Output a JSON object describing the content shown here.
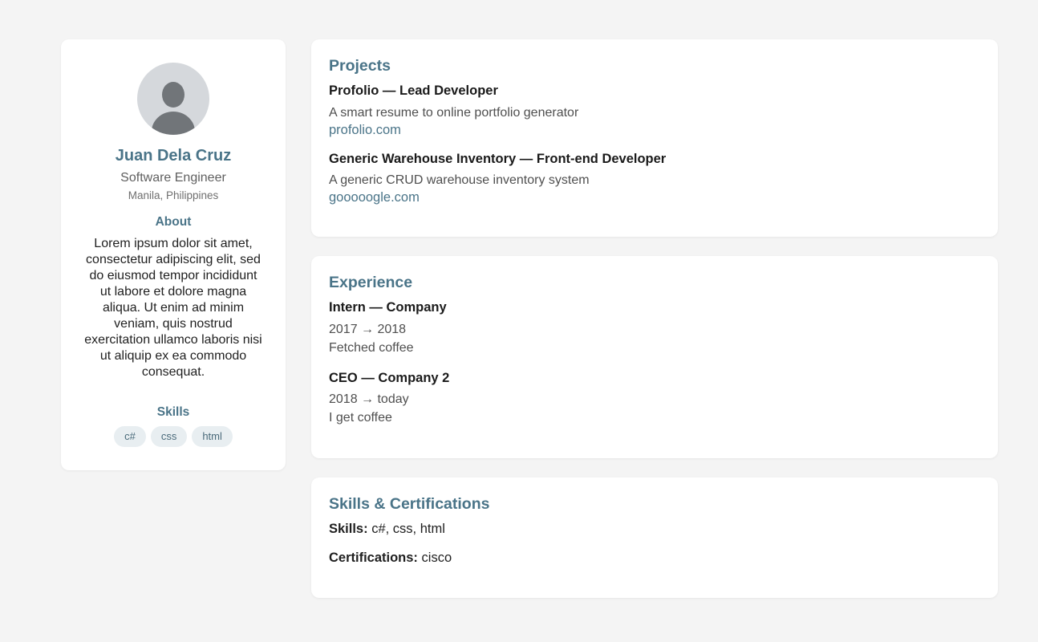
{
  "profile": {
    "name": "Juan Dela Cruz",
    "role": "Software Engineer",
    "location": "Manila, Philippines",
    "about_heading": "About",
    "about_text": "Lorem ipsum dolor sit amet, consectetur adipiscing elit, sed do eiusmod tempor incididunt ut labore et dolore magna aliqua. Ut enim ad minim veniam, quis nostrud exercitation ullamco laboris nisi ut aliquip ex ea commodo consequat.",
    "skills_heading": "Skills",
    "skills": [
      "c#",
      "css",
      "html"
    ]
  },
  "projects": {
    "heading": "Projects",
    "items": [
      {
        "title": "Profolio — Lead Developer",
        "description": "A smart resume to online portfolio generator",
        "link": "profolio.com"
      },
      {
        "title": "Generic Warehouse Inventory — Front-end Developer",
        "description": "A generic CRUD warehouse inventory system",
        "link": "gooooogle.com"
      }
    ]
  },
  "experience": {
    "heading": "Experience",
    "items": [
      {
        "title": "Intern — Company",
        "period": "2017 → 2018",
        "description": "Fetched coffee"
      },
      {
        "title": "CEO — Company 2",
        "period": "2018 → today",
        "description": "I get coffee"
      }
    ]
  },
  "skills_certs": {
    "heading": "Skills & Certifications",
    "skills_label": "Skills:",
    "skills_value": "c#, css, html",
    "certs_label": "Certifications:",
    "certs_value": "cisco"
  },
  "colors": {
    "accent": "#4a7488",
    "background": "#f4f4f4",
    "card": "#ffffff",
    "chip": "#e8eef1"
  }
}
